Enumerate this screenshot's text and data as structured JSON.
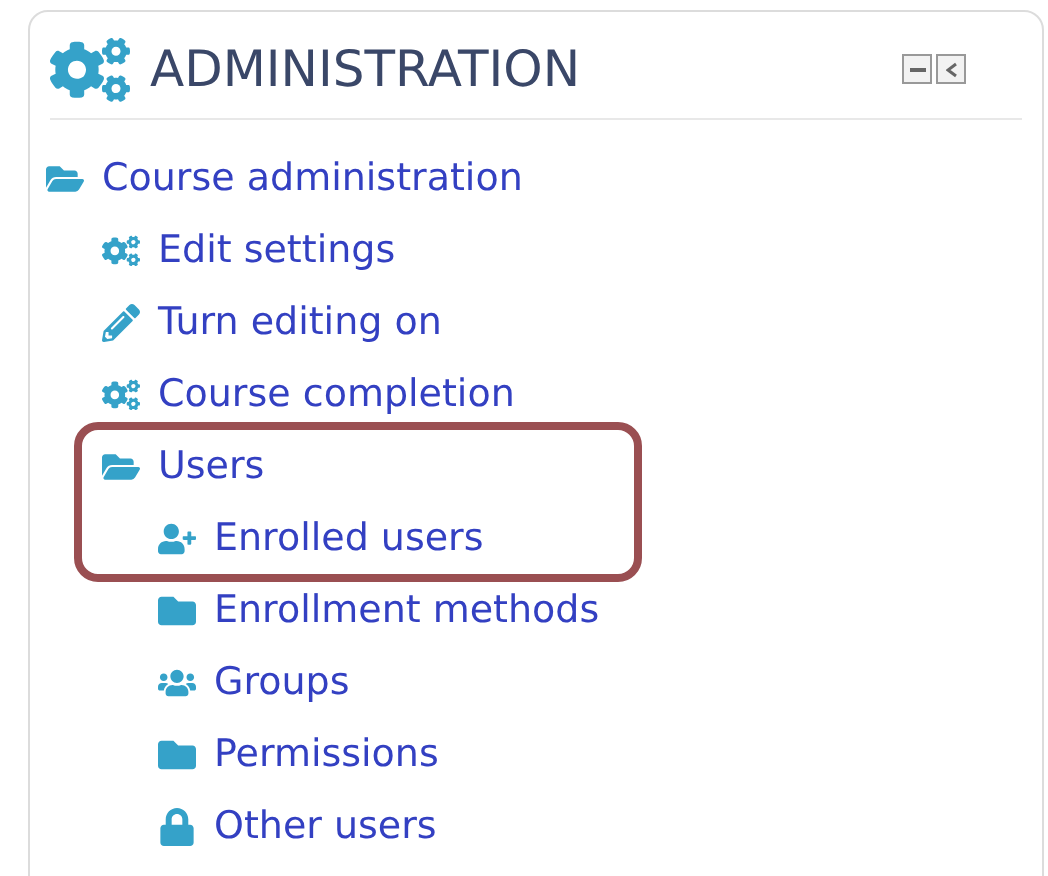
{
  "block": {
    "title": "ADMINISTRATION"
  },
  "tree": [
    {
      "label": "Course administration",
      "kind": "folder",
      "expanded": true,
      "highlighted": false,
      "children": [
        {
          "label": "Edit settings",
          "kind": "gears",
          "highlighted": false
        },
        {
          "label": "Turn editing on",
          "kind": "pencil",
          "highlighted": false
        },
        {
          "label": "Course completion",
          "kind": "gears",
          "highlighted": false
        },
        {
          "label": "Users",
          "kind": "folder",
          "expanded": true,
          "highlighted": true,
          "children": [
            {
              "label": "Enrolled users",
              "kind": "user-plus",
              "highlighted": true
            },
            {
              "label": "Enrollment methods",
              "kind": "folder",
              "expanded": false,
              "highlighted": false
            },
            {
              "label": "Groups",
              "kind": "users",
              "highlighted": false
            },
            {
              "label": "Permissions",
              "kind": "folder",
              "expanded": false,
              "highlighted": false
            },
            {
              "label": "Other users",
              "kind": "lock",
              "highlighted": false
            }
          ]
        }
      ]
    }
  ]
}
